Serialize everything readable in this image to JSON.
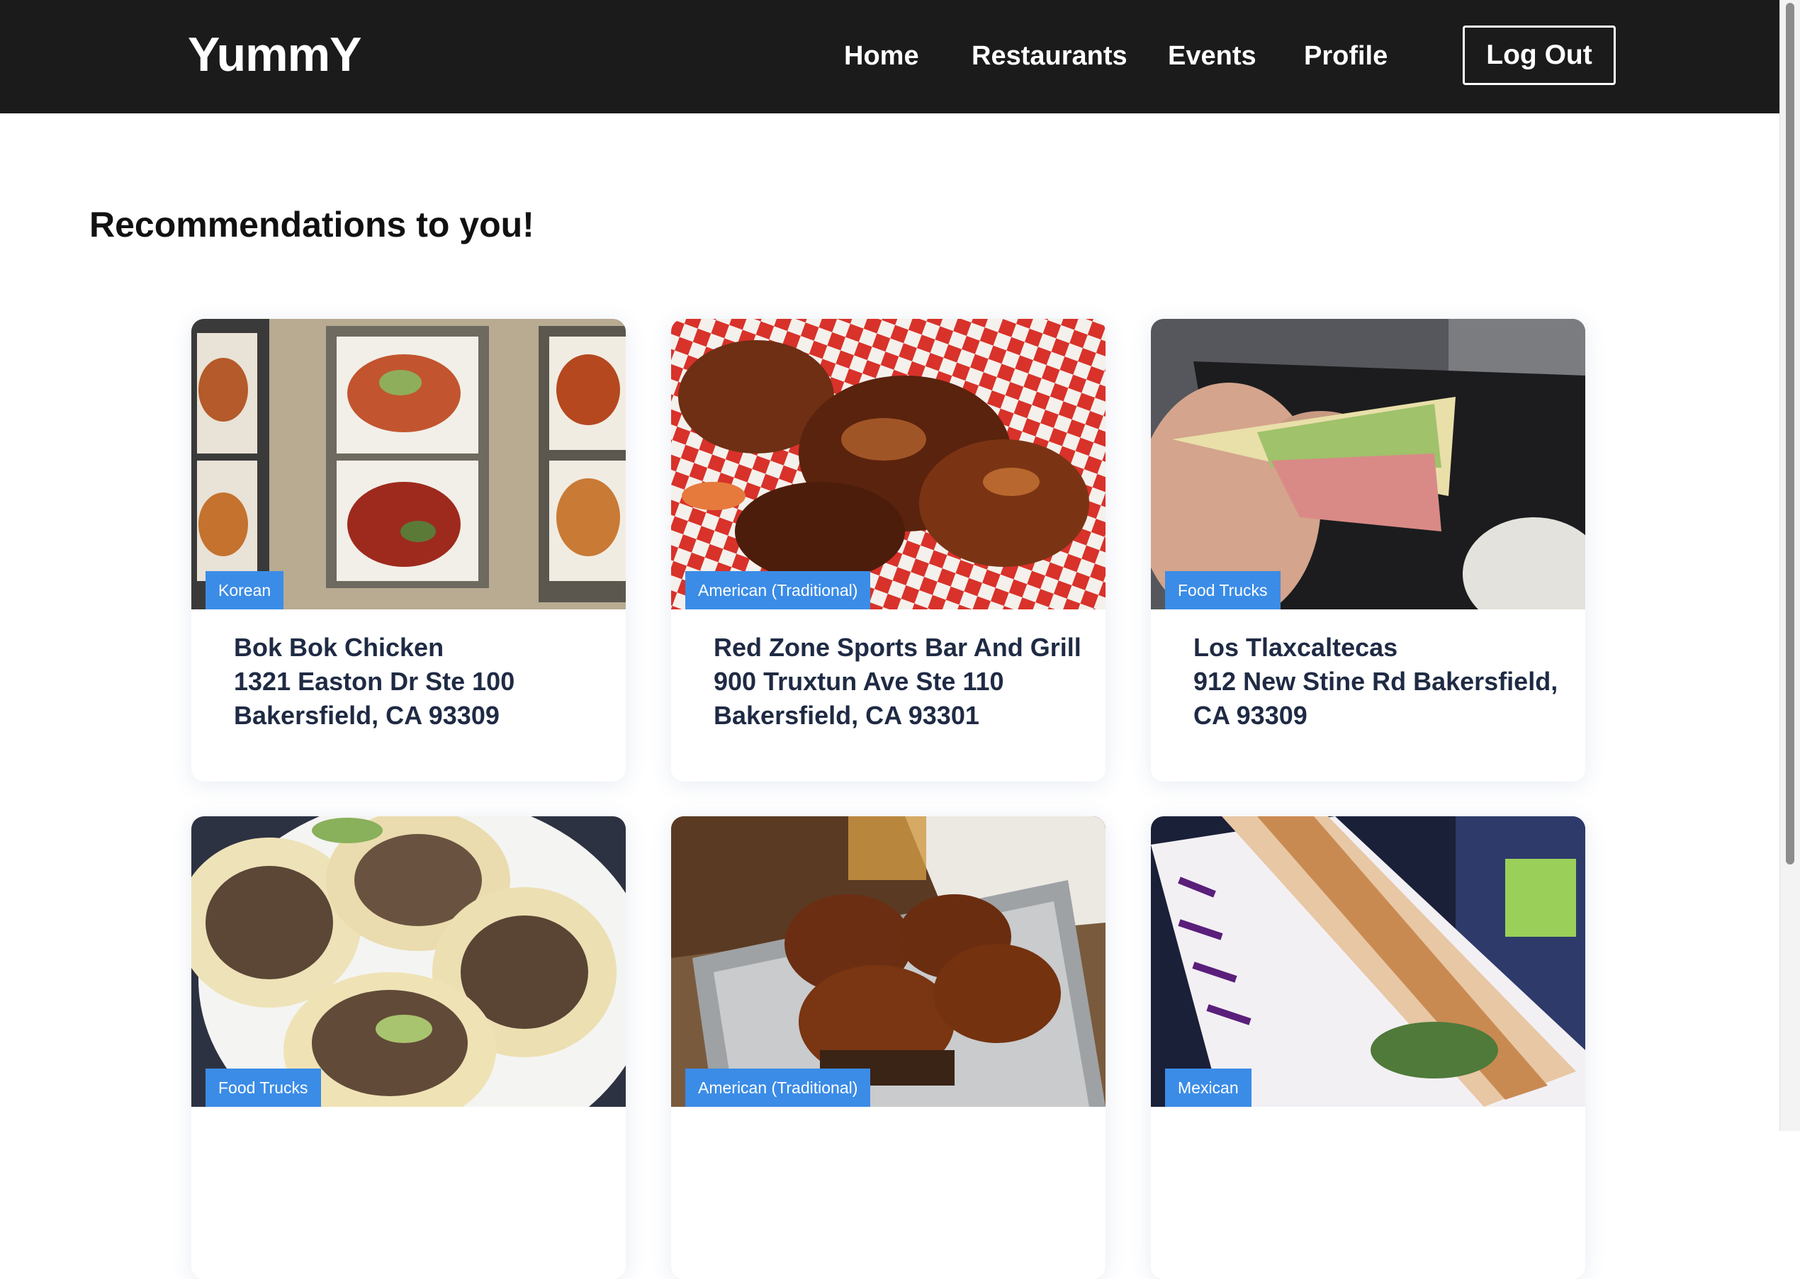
{
  "navbar": {
    "brand": "YummY",
    "links": [
      "Home",
      "Restaurants",
      "Events",
      "Profile"
    ],
    "logout_label": "Log Out"
  },
  "main": {
    "heading": "Recommendations to you!"
  },
  "cards": [
    {
      "category": "Korean",
      "name": "Bok Bok Chicken",
      "address_line1": "1321 Easton Dr Ste 100",
      "address_line2": "Bakersfield, CA 93309"
    },
    {
      "category": "American (Traditional)",
      "name": "Red Zone Sports Bar And Grill",
      "address_line1": "900 Truxtun Ave Ste 110",
      "address_line2": "Bakersfield, CA 93301"
    },
    {
      "category": "Food Trucks",
      "name": "Los Tlaxcaltecas",
      "address_line1": "912 New Stine Rd Bakersfield,",
      "address_line2": "CA 93309"
    },
    {
      "category": "Food Trucks"
    },
    {
      "category": "American (Traditional)"
    },
    {
      "category": "Mexican"
    }
  ],
  "colors": {
    "navbar_bg": "#1b1b1b",
    "badge_bg": "#3b8ce6",
    "card_text": "#1f2a44"
  }
}
